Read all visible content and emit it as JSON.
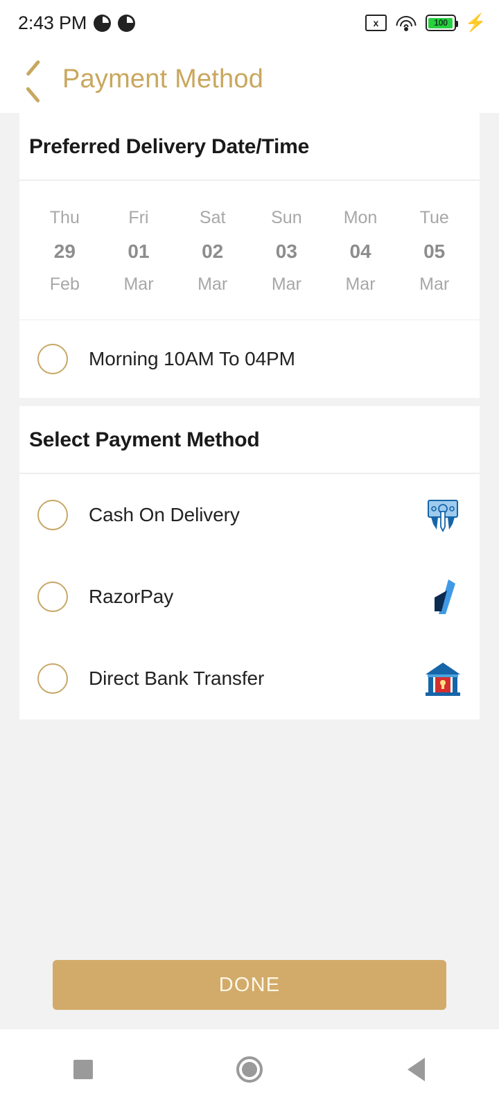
{
  "statusbar": {
    "time": "2:43 PM",
    "notif_icon_1": "half-circle-notification-icon",
    "notif_icon_2": "half-circle-notification-icon",
    "sdcard_x": "x",
    "sdcard_icon": "sdcard-error-icon",
    "wifi_icon": "wifi-icon",
    "battery_level": "100",
    "battery_color": "#26d140",
    "charging_icon": "charging-bolt-icon"
  },
  "appbar": {
    "back_icon": "back-chevron-icon",
    "title": "Payment Method",
    "accent_color": "#c9a75e"
  },
  "delivery": {
    "heading": "Preferred Delivery Date/Time",
    "dates": [
      {
        "day": "Thu",
        "num": "29",
        "month": "Feb"
      },
      {
        "day": "Fri",
        "num": "01",
        "month": "Mar"
      },
      {
        "day": "Sat",
        "num": "02",
        "month": "Mar"
      },
      {
        "day": "Sun",
        "num": "03",
        "month": "Mar"
      },
      {
        "day": "Mon",
        "num": "04",
        "month": "Mar"
      },
      {
        "day": "Tue",
        "num": "05",
        "month": "Mar"
      }
    ],
    "slot": {
      "label": "Morning 10AM To 04PM",
      "selected": false
    }
  },
  "payment": {
    "heading": "Select Payment Method",
    "options": [
      {
        "label": "Cash On Delivery",
        "icon": "cash-on-delivery-icon",
        "selected": false
      },
      {
        "label": "RazorPay",
        "icon": "razorpay-logo-icon",
        "selected": false
      },
      {
        "label": "Direct Bank Transfer",
        "icon": "bank-building-icon",
        "selected": false
      }
    ]
  },
  "footer": {
    "done_label": "DONE",
    "done_color": "#d2ab6a"
  },
  "navbar": {
    "recents": "recents-square-icon",
    "home": "home-circle-icon",
    "back": "back-triangle-icon"
  }
}
